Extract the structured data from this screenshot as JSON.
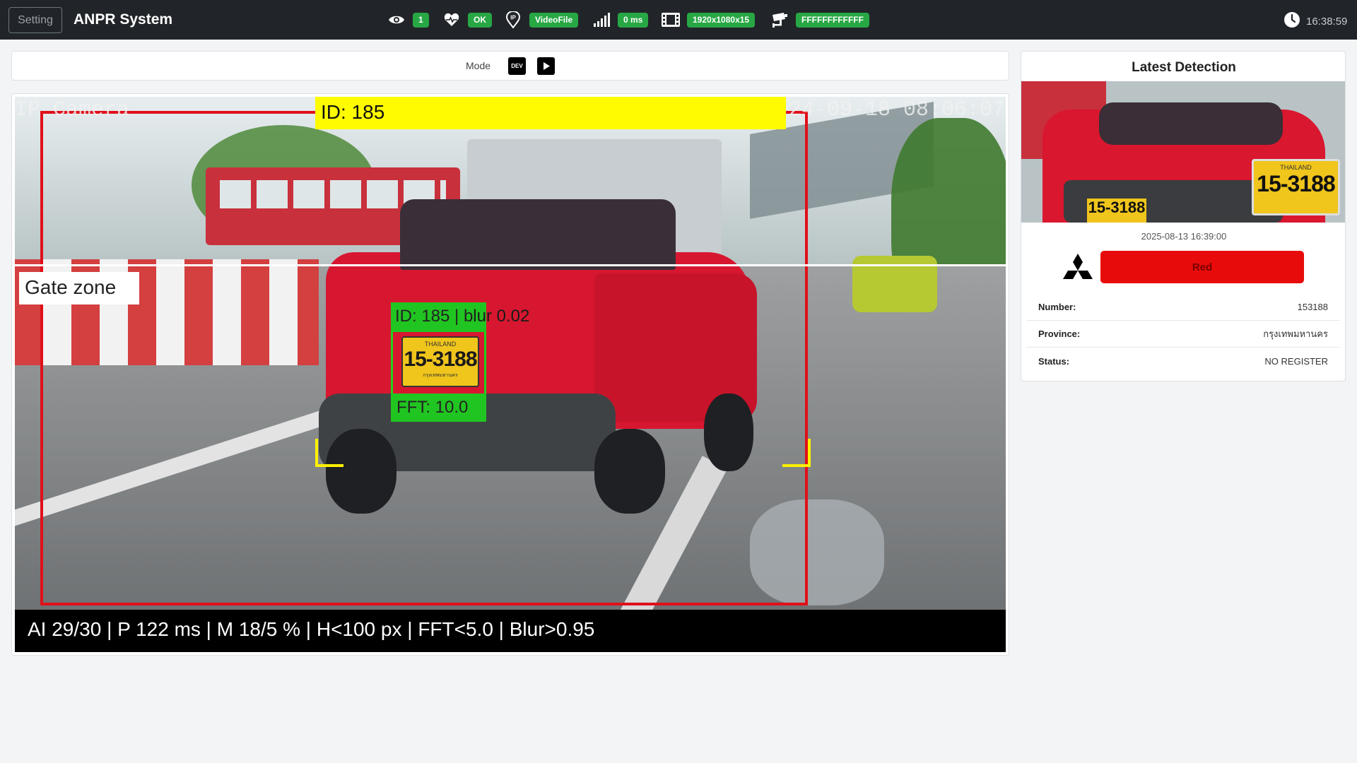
{
  "topbar": {
    "setting_label": "Setting",
    "title": "ANPR System",
    "stats": [
      {
        "icon": "eye-icon",
        "value": "1"
      },
      {
        "icon": "heartbeat-icon",
        "value": "OK"
      },
      {
        "icon": "ip-location-icon",
        "value": "VideoFile"
      },
      {
        "icon": "signal-icon",
        "value": "0 ms"
      },
      {
        "icon": "film-icon",
        "value": "1920x1080x15"
      },
      {
        "icon": "cctv-camera-icon",
        "value": "FFFFFFFFFFFF"
      }
    ],
    "time": "16:38:59"
  },
  "mode": {
    "label": "Mode",
    "dev_label": "DEV"
  },
  "video": {
    "camera_label": "IP Camera",
    "timestamp": "24-09-18 08:06:07",
    "track_id": "ID: 185",
    "zone_label": "Gate zone",
    "plate_header_a": "ID: 185 | b",
    "plate_header_b": "lur 0.02",
    "plate_fft": "FFT: 10.0",
    "plate_country": "THAILAND",
    "plate_number": "15-3188",
    "plate_province": "กรุงเทพมหานคร",
    "status_strip": "AI 29/30 | P 122 ms | M 18/5 % | H<100 px | FFT<5.0 | Blur>0.95"
  },
  "latest": {
    "title": "Latest Detection",
    "thumb_plate": "15-3188",
    "inset_country": "THAILAND",
    "inset_number": "15-3188",
    "datetime": "2025-08-13 16:39:00",
    "brand_icon": "mitsubishi-logo-icon",
    "color_label": "Red",
    "color_hex": "#e80b0b",
    "rows": [
      {
        "key": "Number:",
        "value": "153188"
      },
      {
        "key": "Province:",
        "value": "กรุงเทพมหานคร"
      },
      {
        "key": "Status:",
        "value": "NO REGISTER"
      }
    ]
  },
  "colors": {
    "topbar": "#212529",
    "badge": "#28a745",
    "detection_frame": "#e0101a",
    "track_bar": "#fffb00",
    "plate_box": "#21c521"
  }
}
